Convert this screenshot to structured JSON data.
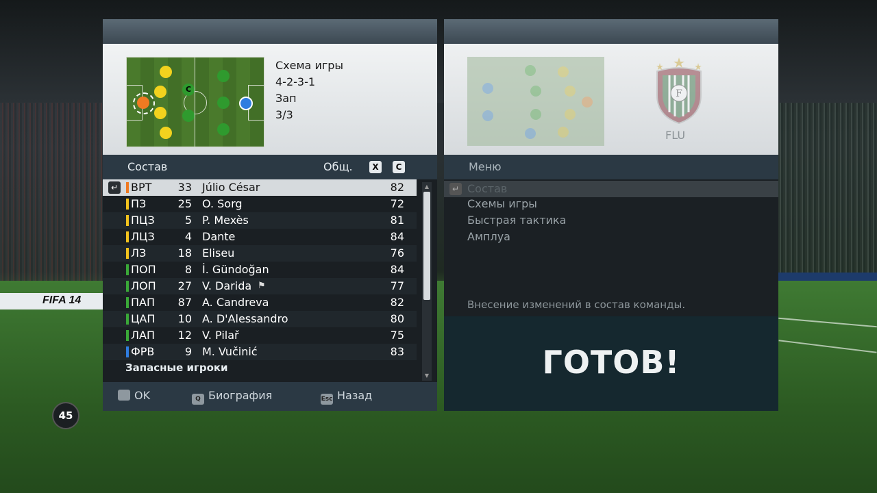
{
  "backdrop": {
    "ad_text": "FIFA 14"
  },
  "left_panel": {
    "scheme_label": "Схема игры",
    "formation": "4-2-3-1",
    "style": "Зап",
    "mentality": "3/3",
    "captain_mark": "C",
    "list_header": "Состав",
    "sort_label": "Общ.",
    "key_x": "X",
    "key_c": "C",
    "enter_glyph": "↵",
    "players": [
      {
        "pos": "ВРТ",
        "num": "33",
        "name": "Júlio César",
        "rating": "82",
        "color": "#f07a22"
      },
      {
        "pos": "ПЗ",
        "num": "25",
        "name": "O. Sorg",
        "rating": "72",
        "color": "#f2c21e"
      },
      {
        "pos": "ПЦЗ",
        "num": "5",
        "name": "P. Mexès",
        "rating": "81",
        "color": "#f2c21e"
      },
      {
        "pos": "ЛЦЗ",
        "num": "4",
        "name": "Dante",
        "rating": "84",
        "color": "#f2c21e"
      },
      {
        "pos": "ЛЗ",
        "num": "18",
        "name": "Eliseu",
        "rating": "76",
        "color": "#f2c21e"
      },
      {
        "pos": "ПОП",
        "num": "8",
        "name": "İ. Gündoğan",
        "rating": "84",
        "color": "#3aa838"
      },
      {
        "pos": "ЛОП",
        "num": "27",
        "name": "V. Darida",
        "rating": "77",
        "color": "#3aa838",
        "flag": "⚑"
      },
      {
        "pos": "ПАП",
        "num": "87",
        "name": "A. Candreva",
        "rating": "82",
        "color": "#3aa838"
      },
      {
        "pos": "ЦАП",
        "num": "10",
        "name": "A. D'Alessandro",
        "rating": "80",
        "color": "#3aa838"
      },
      {
        "pos": "ЛАП",
        "num": "12",
        "name": "V. Pilař",
        "rating": "75",
        "color": "#3aa838"
      },
      {
        "pos": "ФРВ",
        "num": "9",
        "name": "M. Vučinić",
        "rating": "83",
        "color": "#2f7de0"
      }
    ],
    "subs_label": "Запасные игроки",
    "footer": {
      "ok": "OK",
      "bio_key": "Q",
      "bio": "Биография",
      "back_key": "Esc",
      "back": "Назад"
    }
  },
  "right_panel": {
    "team_abbr": "FLU",
    "menu_header": "Меню",
    "menu_items": [
      "Состав",
      "Схемы игры",
      "Быстрая тактика",
      "Амплуа"
    ],
    "description": "Внесение изменений в состав команды.",
    "ready_label": "ГОТОВ!"
  },
  "timer": "45"
}
